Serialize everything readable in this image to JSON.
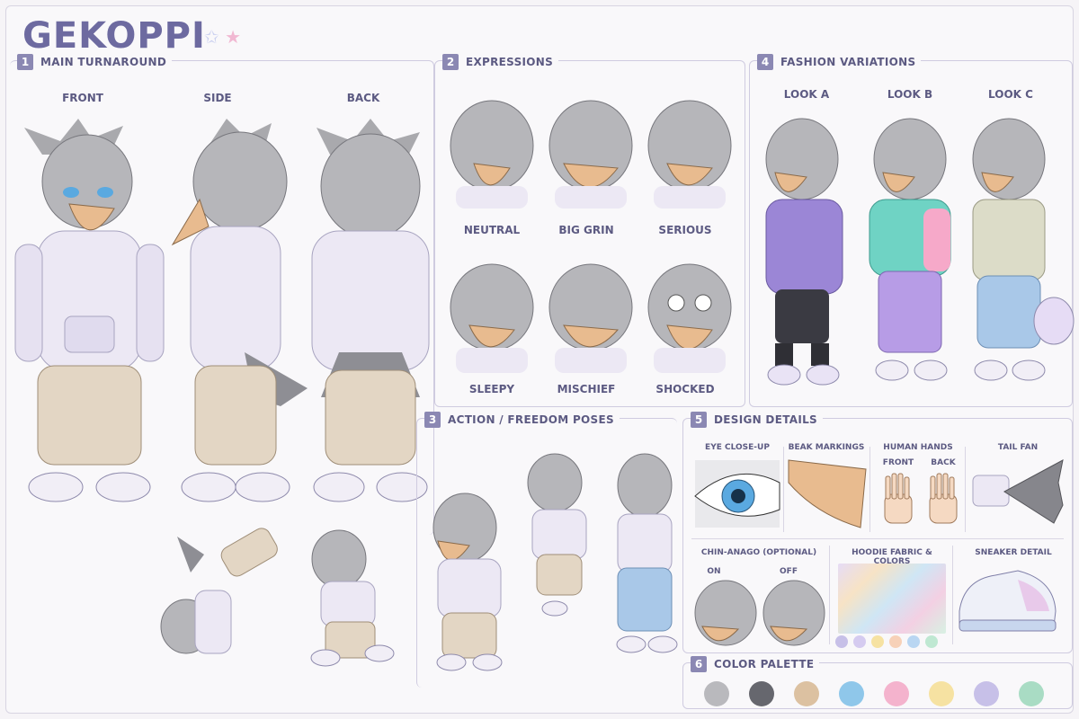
{
  "title": "GEKOPPI",
  "sections": {
    "turnaround": {
      "num": "1",
      "title": "MAIN TURNAROUND",
      "views": [
        "FRONT",
        "SIDE",
        "BACK"
      ]
    },
    "expressions": {
      "num": "2",
      "title": "EXPRESSIONS",
      "items": [
        "NEUTRAL",
        "BIG GRIN",
        "SERIOUS",
        "SLEEPY",
        "MISCHIEF",
        "SHOCKED"
      ]
    },
    "action": {
      "num": "3",
      "title": "ACTION / FREEDOM POSES"
    },
    "fashion": {
      "num": "4",
      "title": "FASHION VARIATIONS",
      "looks": [
        "LOOK A",
        "LOOK B",
        "LOOK C"
      ]
    },
    "details": {
      "num": "5",
      "title": "DESIGN DETAILS",
      "eye": "EYE CLOSE-UP",
      "beak": "BEAK MARKINGS",
      "hands": "HUMAN HANDS",
      "hands_front": "FRONT",
      "hands_back": "BACK",
      "tail": "TAIL FAN",
      "chin": "CHIN-ANAGO (OPTIONAL)",
      "chin_on": "ON",
      "chin_off": "OFF",
      "fabric": "HOODIE FABRIC & COLORS",
      "sneaker": "SNEAKER DETAIL"
    },
    "palette": {
      "num": "6",
      "title": "COLOR PALETTE",
      "colors": [
        "#b9b9bd",
        "#66676e",
        "#dcc1a1",
        "#8fc7ea",
        "#f4b3cd",
        "#f6e2a2",
        "#c7c0e8",
        "#a9dcc4"
      ]
    }
  },
  "fabric_dots": [
    "#c7c0e8",
    "#d5cbf0",
    "#f6e2a2",
    "#f7d1b8",
    "#b9d6f2",
    "#bfe8d2"
  ]
}
